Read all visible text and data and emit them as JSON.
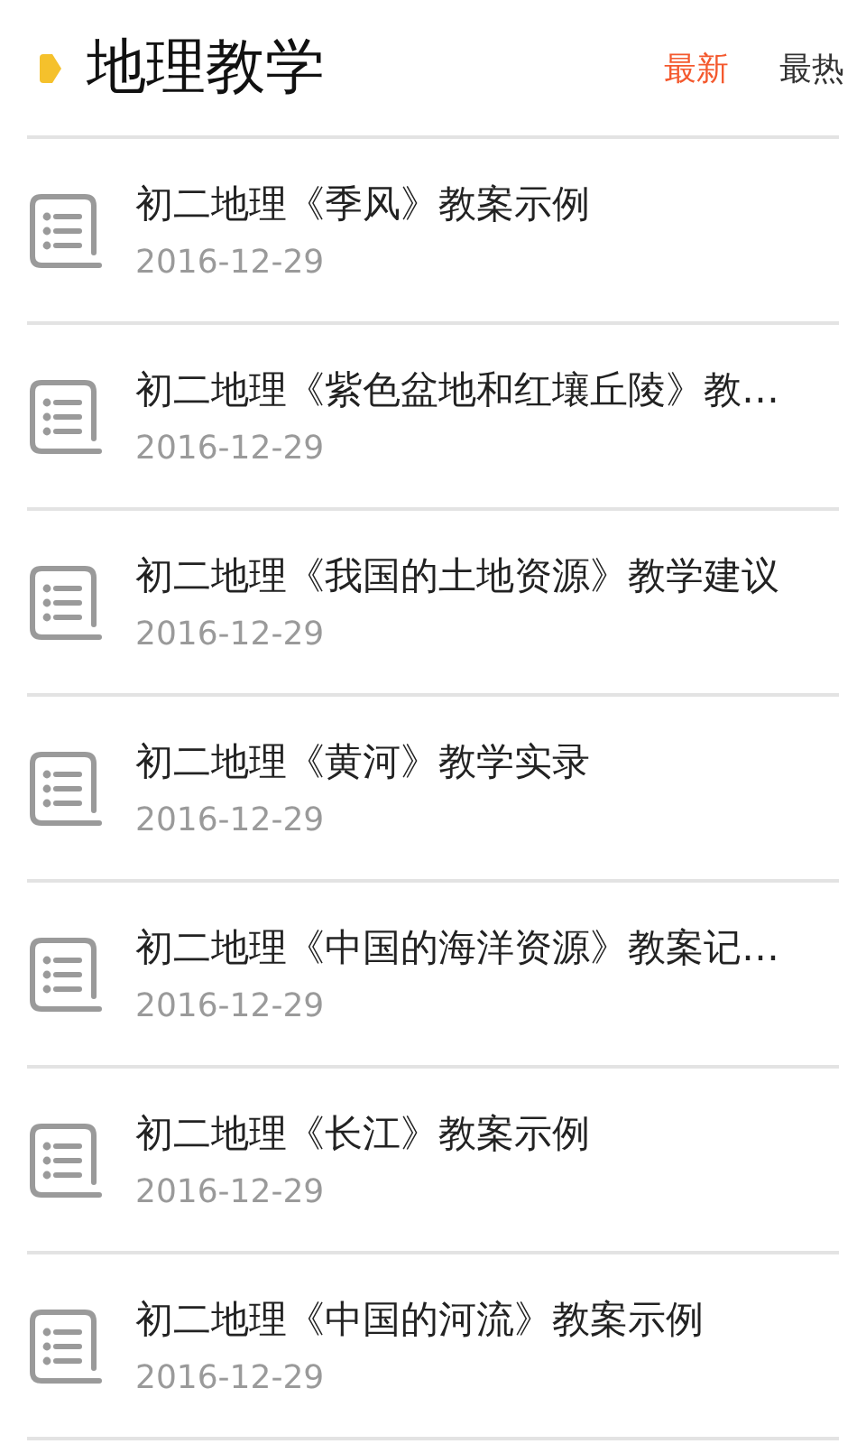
{
  "header": {
    "title": "地理教学",
    "tabs": [
      {
        "label": "最新",
        "selected": true
      },
      {
        "label": "最热",
        "selected": false
      }
    ]
  },
  "articles": [
    {
      "title": "初二地理《季风》教案示例",
      "date": "2016-12-29"
    },
    {
      "title": "初二地理《紫色盆地和红壤丘陵》教…",
      "date": "2016-12-29"
    },
    {
      "title": "初二地理《我国的土地资源》教学建议",
      "date": "2016-12-29"
    },
    {
      "title": "初二地理《黄河》教学实录",
      "date": "2016-12-29"
    },
    {
      "title": "初二地理《中国的海洋资源》教案记…",
      "date": "2016-12-29"
    },
    {
      "title": "初二地理《长江》教案示例",
      "date": "2016-12-29"
    },
    {
      "title": "初二地理《中国的河流》教案示例",
      "date": "2016-12-29"
    }
  ]
}
